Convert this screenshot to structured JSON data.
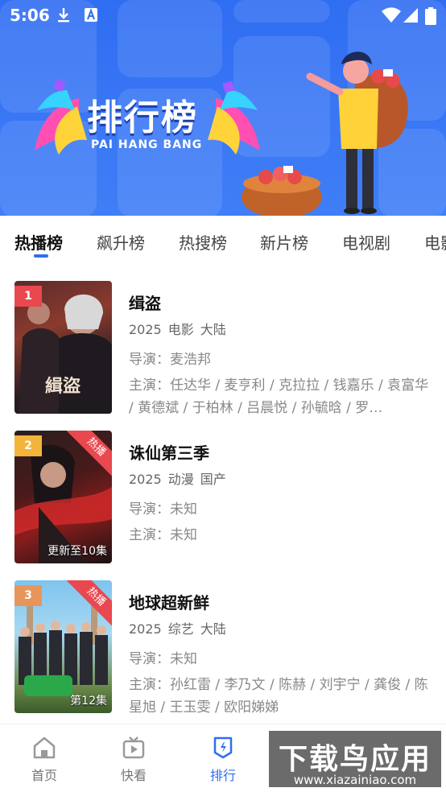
{
  "status_bar": {
    "time": "5:06"
  },
  "banner": {
    "title": "排行榜",
    "subtitle": "PAI HANG BANG"
  },
  "tabs": [
    "热播榜",
    "飙升榜",
    "热搜榜",
    "新片榜",
    "电视剧",
    "电影"
  ],
  "list": [
    {
      "rank": "1",
      "title": "缉盗",
      "year": "2025",
      "type": "电影",
      "region": "大陆",
      "director": "导演：麦浩邦",
      "cast": "主演：任达华 / 麦亨利 / 克拉拉 / 钱嘉乐 / 袁富华 / 黄德斌 / 于柏林 / 吕晨悦 / 孙毓晗 / 罗…",
      "hot": "",
      "caption": ""
    },
    {
      "rank": "2",
      "title": "诛仙第三季",
      "year": "2025",
      "type": "动漫",
      "region": "国产",
      "director": "导演：未知",
      "cast": "主演：未知",
      "hot": "热播",
      "caption": "更新至10集"
    },
    {
      "rank": "3",
      "title": "地球超新鲜",
      "year": "2025",
      "type": "综艺",
      "region": "大陆",
      "director": "导演：未知",
      "cast": "主演：孙红雷 / 李乃文 / 陈赫 / 刘宇宁 / 龚俊 / 陈星旭 / 王玉雯 / 欧阳娣娣",
      "hot": "热播",
      "caption": "第12集"
    }
  ],
  "bottom_nav": [
    {
      "label": "首页",
      "icon": "home-icon"
    },
    {
      "label": "快看",
      "icon": "tv-play-icon"
    },
    {
      "label": "排行",
      "icon": "ranking-icon"
    }
  ],
  "watermark": {
    "big": "下载鸟应用",
    "small": "www.xiazainiao.com"
  },
  "colors": {
    "accent": "#2f6df2",
    "rank1": "#e8484e",
    "rank2": "#f2b43a",
    "rank3": "#e7955b"
  }
}
